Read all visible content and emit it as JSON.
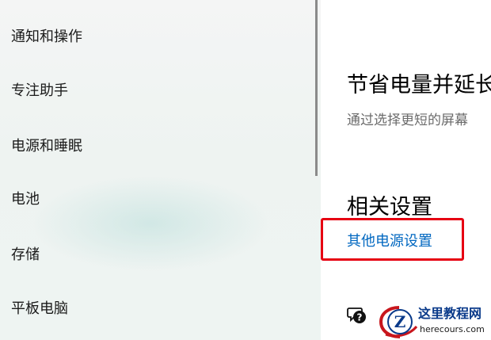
{
  "sidebar": {
    "items": [
      {
        "label": "通知和操作"
      },
      {
        "label": "专注助手"
      },
      {
        "label": "电源和睡眠"
      },
      {
        "label": "电池"
      },
      {
        "label": "存储"
      },
      {
        "label": "平板电脑"
      }
    ]
  },
  "main": {
    "title": "节省电量并延长",
    "description": "通过选择更短的屏幕",
    "related_heading": "相关设置",
    "related_link": "其他电源设置"
  },
  "watermark": {
    "title": "这里教程网",
    "url": "herecours.com"
  },
  "colors": {
    "link": "#0067c0",
    "highlight": "#e60012"
  }
}
